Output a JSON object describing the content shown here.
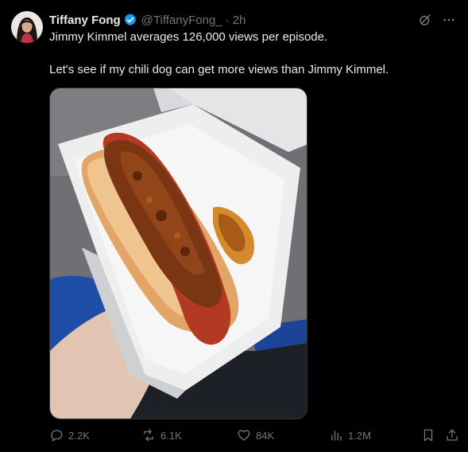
{
  "tweet": {
    "author": {
      "display_name": "Tiffany Fong",
      "handle": "@TiffanyFong_",
      "verified": true,
      "verified_color": "#1d9bf0"
    },
    "separator": "·",
    "time": "2h",
    "text_line_1": "Jimmy Kimmel averages 126,000 views per episode.",
    "text_line_2": "Let's see if my chili dog can get more views than Jimmy Kimmel.",
    "media": {
      "icon": "photo-chili-dog"
    },
    "top_icons": [
      "grok-icon",
      "more-icon"
    ],
    "actions": {
      "replies": "2.2K",
      "reposts": "6.1K",
      "likes": "84K",
      "views": "1.2M"
    },
    "colors": {
      "background": "#000000",
      "text": "#e7e9ea",
      "secondary": "#71767b"
    }
  }
}
